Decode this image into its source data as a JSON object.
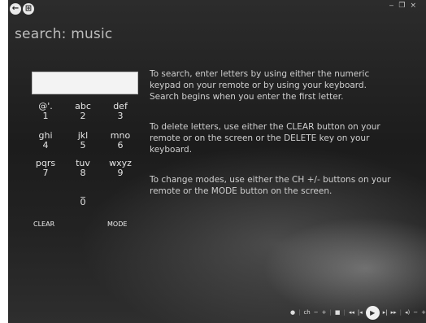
{
  "window": {
    "minimize": "‒",
    "restore": "❐",
    "close": "×"
  },
  "nav": {
    "back": "←",
    "start": "⊞"
  },
  "title": "search: music",
  "search": {
    "value": ""
  },
  "keypad": {
    "keys": [
      {
        "letters": "@'.",
        "digit": "1"
      },
      {
        "letters": "abc",
        "digit": "2"
      },
      {
        "letters": "def",
        "digit": "3"
      },
      {
        "letters": "ghi",
        "digit": "4"
      },
      {
        "letters": "jkl",
        "digit": "5"
      },
      {
        "letters": "mno",
        "digit": "6"
      },
      {
        "letters": "pqrs",
        "digit": "7"
      },
      {
        "letters": "tuv",
        "digit": "8"
      },
      {
        "letters": "wxyz",
        "digit": "9"
      },
      {
        "letters": "_",
        "digit": "0"
      }
    ],
    "clear": "CLEAR",
    "mode": "MODE"
  },
  "instructions": [
    "To search, enter letters by using either the numeric keypad on your remote or by using your keyboard. Search begins when you enter the first letter.",
    "To delete letters, use either the CLEAR button on your remote or on the screen or the DELETE key on your keyboard.",
    "To change modes, use either the CH +/- buttons on your remote or the MODE button on the screen."
  ],
  "transport": {
    "record": "●",
    "ch": "ch",
    "ch_minus": "−",
    "ch_plus": "+",
    "stop": "■",
    "rewind": "◂◂",
    "prev": "|◂",
    "play": "▶",
    "next": "▸|",
    "ffwd": "▸▸",
    "vol": "◂)",
    "vol_minus": "−",
    "vol_plus": "+"
  }
}
